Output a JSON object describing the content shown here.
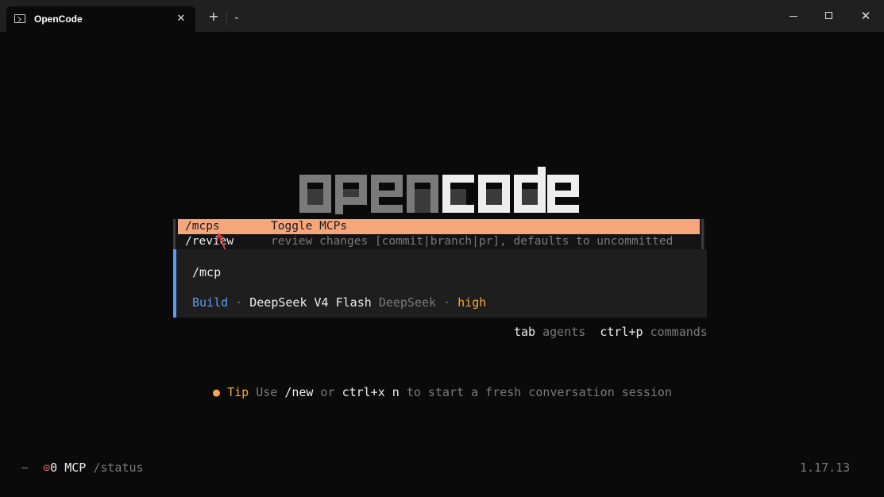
{
  "window": {
    "tab_title": "OpenCode",
    "tab_close": "✕",
    "new_tab": "+",
    "dropdown": "⌄",
    "close": "✕"
  },
  "logo": {
    "text_dim": "open",
    "text_bright": "code"
  },
  "autocomplete": {
    "items": [
      {
        "command": "/mcps",
        "description": "Toggle MCPs",
        "selected": true
      },
      {
        "command": "/review",
        "description": "review changes [commit|branch|pr], defaults to uncommitted",
        "selected": false
      }
    ]
  },
  "prompt": {
    "input_value": "/mcp",
    "agent": "Build",
    "separator": "·",
    "model": "DeepSeek V4 Flash",
    "provider": "DeepSeek",
    "variant": "high"
  },
  "hints": [
    {
      "key": "tab",
      "label": "agents"
    },
    {
      "key": "ctrl+p",
      "label": "commands"
    }
  ],
  "tip": {
    "bullet": "●",
    "label": "Tip",
    "parts": [
      "Use",
      "/new",
      "or",
      "ctrl+x n",
      "to start a fresh conversation session"
    ]
  },
  "footer": {
    "cwd": "~",
    "mcp_icon": "⊙",
    "mcp_count": "0",
    "mcp_label": "MCP",
    "status_command": "/status",
    "version": "1.17.13"
  },
  "colors": {
    "selection": "#f5a67a",
    "accent_blue": "#5c9cf5",
    "accent_orange": "#f5a742",
    "error_red": "#e06c75"
  }
}
